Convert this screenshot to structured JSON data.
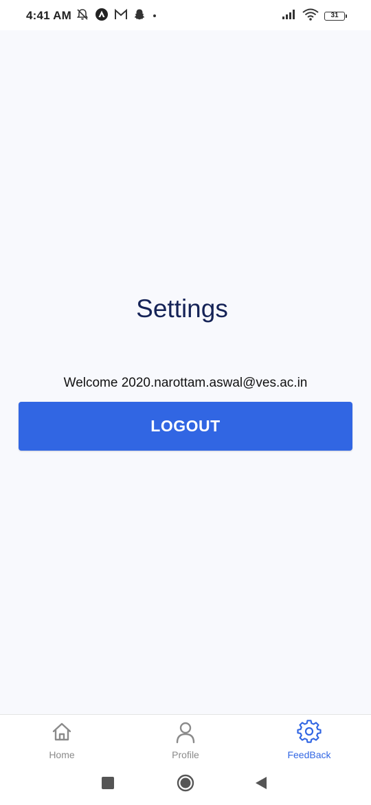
{
  "status_bar": {
    "time": "4:41 AM",
    "left_icons": [
      "mute-icon",
      "app-icon",
      "gmail-icon",
      "snapchat-icon",
      "dot-icon"
    ],
    "right_icons": [
      "signal-icon",
      "wifi-icon",
      "battery-icon"
    ],
    "battery_level": "31"
  },
  "page": {
    "title": "Settings",
    "welcome_text": "Welcome 2020.narottam.aswal@ves.ac.in",
    "logout_label": "LOGOUT"
  },
  "bottom_nav": {
    "items": [
      {
        "label": "Home",
        "icon": "home-icon",
        "active": false
      },
      {
        "label": "Profile",
        "icon": "person-icon",
        "active": false
      },
      {
        "label": "FeedBack",
        "icon": "gear-icon",
        "active": true
      }
    ]
  },
  "system_nav": {
    "buttons": [
      "recents-button",
      "home-button",
      "back-button"
    ]
  },
  "colors": {
    "accent": "#3166e3",
    "title": "#152357",
    "background": "#f8f9fd",
    "inactive": "#8a8a8a"
  }
}
